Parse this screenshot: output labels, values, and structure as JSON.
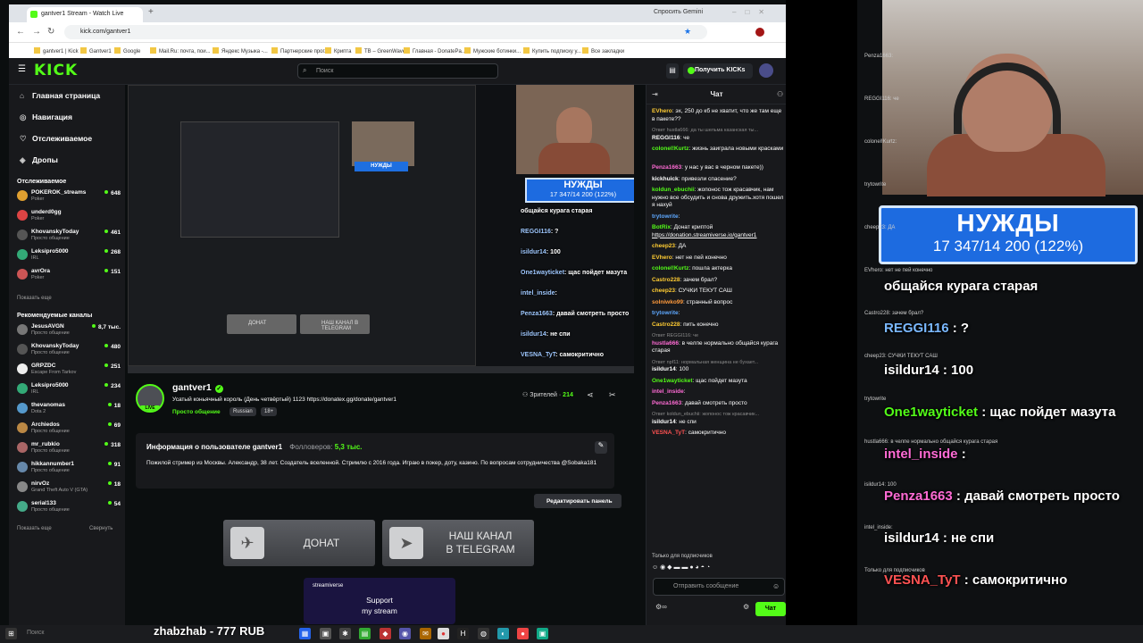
{
  "browser": {
    "tab_title": "gantver1 Stream - Watch Live",
    "new_tab": "+",
    "gemini_button": "Спросить Gemini",
    "url": "kick.com/gantver1",
    "bookmarks": [
      "gantver1 | Kick",
      "Gantver1",
      "Google",
      "Mail.Ru: почта, пои...",
      "Яндекс Музыка -...",
      "Партнерские прог...",
      "Крипта",
      "ТВ – GreenWave",
      "Главная - DonatePa...",
      "Мужские ботинки...",
      "Купить подписку у...",
      "Все закладки"
    ]
  },
  "kick": {
    "logo": "KICK",
    "search_placeholder": "Поиск",
    "get_kicks": "Получить KICKs",
    "nav": [
      {
        "icon": "home-icon",
        "glyph": "⌂",
        "label": "Главная страница"
      },
      {
        "icon": "compass-icon",
        "glyph": "◎",
        "label": "Навигация"
      },
      {
        "icon": "heart-icon",
        "glyph": "♡",
        "label": "Отслеживаемое"
      },
      {
        "icon": "gift-icon",
        "glyph": "◈",
        "label": "Дропы"
      }
    ],
    "following_title": "Отслеживаемое",
    "following": [
      {
        "name": "POKEROK_streams",
        "cat": "Poker",
        "viewers": "648",
        "color": "#e0a030"
      },
      {
        "name": "underd0gg",
        "cat": "Poker",
        "viewers": "",
        "color": "#d44"
      },
      {
        "name": "KhovanskyToday",
        "cat": "Просто общение",
        "viewers": "461",
        "color": "#555"
      },
      {
        "name": "Leksipro5000",
        "cat": "IRL",
        "viewers": "268",
        "color": "#3a7"
      },
      {
        "name": "avrOra",
        "cat": "Poker",
        "viewers": "151",
        "color": "#c55"
      }
    ],
    "show_more": "Показать еще",
    "recommended_title": "Рекомендуемые каналы",
    "recommended": [
      {
        "name": "JesusAVGN",
        "cat": "Просто общение",
        "viewers": "8,7 тыс.",
        "color": "#777"
      },
      {
        "name": "KhovanskyToday",
        "cat": "Просто общение",
        "viewers": "480",
        "color": "#555"
      },
      {
        "name": "GRPZDC",
        "cat": "Escape From Tarkov",
        "viewers": "251",
        "color": "#eee"
      },
      {
        "name": "Leksipro5000",
        "cat": "IRL",
        "viewers": "234",
        "color": "#3a7"
      },
      {
        "name": "thevanomas",
        "cat": "Dota 2",
        "viewers": "18",
        "color": "#59c"
      },
      {
        "name": "Archiedos",
        "cat": "Просто общение",
        "viewers": "69",
        "color": "#b84"
      },
      {
        "name": "mr_rubkio",
        "cat": "Просто общение",
        "viewers": "318",
        "color": "#a66"
      },
      {
        "name": "hikkannumber1",
        "cat": "Просто общение",
        "viewers": "91",
        "color": "#68a"
      },
      {
        "name": "nirvOz",
        "cat": "Grand Theft Auto V (GTA)",
        "viewers": "18",
        "color": "#888"
      },
      {
        "name": "serial133",
        "cat": "Просто общение",
        "viewers": "54",
        "color": "#4a8"
      }
    ],
    "show_more2": "Показать еще",
    "collapse": "Свернуть"
  },
  "video": {
    "overlay_title": "НУЖДЫ",
    "overlay_progress": "17 347/14 200 (122%)",
    "chat_lines": [
      {
        "u": "",
        "t": "общайся курага старая"
      },
      {
        "u": "REGGI116",
        "t": ": ?"
      },
      {
        "u": "isildur14",
        "t": ": 100"
      },
      {
        "u": "One1wayticket",
        "t": ": щас пойдет мазута"
      },
      {
        "u": "intel_inside",
        "t": ":"
      },
      {
        "u": "Penza1663",
        "t": ": давай смотреть просто"
      },
      {
        "u": "isildur14",
        "t": ": не спи"
      },
      {
        "u": "VESNA_TyT",
        "t": ": самокритично"
      }
    ],
    "shot_btn1": "ДОНАТ",
    "shot_btn2": "НАШ КАНАЛ В TELEGRAM"
  },
  "streamer": {
    "name": "gantver1",
    "live": "LIVE",
    "title": "Усатый коньячный король (День четвёртый) 1123 https://donatex.gg/donate/gantver1",
    "category": "Просто общение",
    "tags": [
      "Russian",
      "18+"
    ],
    "viewers_label": "Зрителей · ",
    "viewers": "214"
  },
  "about": {
    "title": "Информация о пользователе gantver1",
    "followers_label": "Фолловеров:",
    "followers": "5,3 тыс.",
    "text": "Пожилой стример из Москвы. Александр, 38 лет. Создатель вселенной. Стримлю с 2016 года. Играю в покер, доту, казино. По вопросам сотрудничества @Sobaka181"
  },
  "panels": {
    "edit": "Редактировать панель",
    "donate": "ДОНАТ",
    "telegram_line1": "НАШ КАНАЛ",
    "telegram_line2": "В TELEGRAM",
    "support_brand": "streamiverse",
    "support_line1": "Support",
    "support_line2": "my stream"
  },
  "chat": {
    "title": "Чат",
    "messages": [
      {
        "u": "EVhero",
        "c": "#ffcc33",
        "t": "эх, 250 до кб не хватит, что же там еще в пакете??"
      },
      {
        "u": "REGGI116",
        "c": "#ffffff",
        "t": "че",
        "rep": "Ответ hustla666: да ты шельма казанская ты..."
      },
      {
        "u": "colonel!Kurtz",
        "c": "#53fc18",
        "t": "жизнь заиграла новыми красками"
      },
      {
        "u": "Penza1663",
        "c": "#ff6bd5",
        "t": "у нас у вас в черном пакете))"
      },
      {
        "u": "kickhuick",
        "c": "#ffffff",
        "t": "привезли спасение?"
      },
      {
        "u": "koldun_ebuchii",
        "c": "#53fc18",
        "t": "жопонос тож красавчик, нам нужно все обсудить и снова дружить.хотя пошел я нахуй"
      },
      {
        "u": "trytowrite",
        "c": "#5ea8ff",
        "t": ""
      },
      {
        "u": "BotRix",
        "c": "#53fc18",
        "t": "Донат криптой",
        "link": "https://donation.streamiverse.io/gantver1"
      },
      {
        "u": "cheep23",
        "c": "#ffcc33",
        "t": "ДА"
      },
      {
        "u": "EVhero",
        "c": "#ffcc33",
        "t": "нет не пей конечно"
      },
      {
        "u": "colonel!Kurtz",
        "c": "#53fc18",
        "t": "пошла актерка"
      },
      {
        "u": "Castro228",
        "c": "#ffcc33",
        "t": "зачем брал?"
      },
      {
        "u": "cheep23",
        "c": "#ffcc33",
        "t": "СУЧКИ ТЕКУТ САШ"
      },
      {
        "u": "solniwko99",
        "c": "#ff9a3c",
        "t": "странный вопрос"
      },
      {
        "u": "trytowrite",
        "c": "#5ea8ff",
        "t": ""
      },
      {
        "u": "Castro228",
        "c": "#ffcc33",
        "t": "пить конечно"
      },
      {
        "u": "hustla666",
        "c": "#ff6bd5",
        "t": "в челпе нормально общайся курага старая",
        "rep": "Ответ REGGI116: че"
      },
      {
        "u": "isildur14",
        "c": "#ffffff",
        "t": "100",
        "rep": "Ответ npf11: нормальная женщина не бухает..."
      },
      {
        "u": "One1wayticket",
        "c": "#53fc18",
        "t": "щас пойдет мазута"
      },
      {
        "u": "intel_inside",
        "c": "#ff6bd5",
        "t": ""
      },
      {
        "u": "Penza1663",
        "c": "#ff6bd5",
        "t": "давай смотреть просто"
      },
      {
        "u": "isildur14",
        "c": "#ffffff",
        "t": "не спи",
        "rep": "Ответ koldun_ebuchii: жопонос тож красавчик..."
      },
      {
        "u": "VESNA_TyT",
        "c": "#ff5252",
        "t": "самокритично"
      }
    ],
    "subs_only": "Только для подписчиков",
    "input_placeholder": "Отправить сообщение",
    "send": "Чат"
  },
  "overlay": {
    "title": "НУЖДЫ",
    "progress": "17 347/14 200 (122%)",
    "big_lines": [
      {
        "u": "",
        "t": "общайся курага старая",
        "c": "#ffffff"
      },
      {
        "u": "REGGI116",
        "t": " : ?",
        "c": "#7ab8ff"
      },
      {
        "u": "isildur14",
        "t": " : 100",
        "c": "#ffffff"
      },
      {
        "u": "One1wayticket",
        "t": " : щас пойдет мазута",
        "c": "#53fc18"
      },
      {
        "u": "intel_inside",
        "t": " :",
        "c": "#ff6bd5"
      },
      {
        "u": "Penza1663",
        "t": " : давай смотреть просто",
        "c": "#ff6bd5"
      },
      {
        "u": "isildur14",
        "t": " : не спи",
        "c": "#ffffff"
      },
      {
        "u": "VESNA_TyT",
        "t": " : самокритично",
        "c": "#ff5252"
      }
    ],
    "small_lines": [
      "Penza1663:",
      "REGGI116: че",
      "colonel!Kurtz:",
      "trytowrite",
      "cheep23: ДА",
      "EVhero: нет не пей конечно",
      "Castro228: зачем брал?",
      "cheep23: СУЧКИ ТЕКУТ САШ",
      "trytowrite",
      "hustla666: в челпе нормально общайся курага старая",
      "isildur14: 100",
      "intel_inside:",
      "Только для подписчиков"
    ]
  },
  "taskbar": {
    "donation_text": "zhabzhab - 777 RUB",
    "search": "Поиск"
  }
}
